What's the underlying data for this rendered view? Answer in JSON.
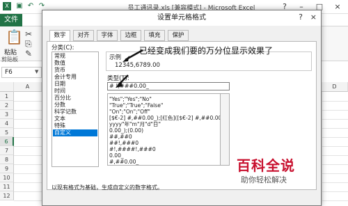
{
  "excel": {
    "title": "员工通讯录.xls [兼容模式] - Microsoft Excel",
    "file_tab": "文件",
    "paste_label": "粘贴",
    "clipboard_label": "剪贴板",
    "name_box": "F6",
    "columns": [
      "A",
      "B",
      "C",
      "D"
    ],
    "rows": [
      "1",
      "2",
      "3",
      "4",
      "5",
      "6",
      "7",
      "8",
      "9",
      "10",
      "11",
      "12"
    ],
    "selected_row": "6",
    "accent": "#217346"
  },
  "dialog": {
    "title": "设置单元格格式",
    "help": "?",
    "close": "×",
    "tabs": [
      "数字",
      "对齐",
      "字体",
      "边框",
      "填充",
      "保护"
    ],
    "active_tab": "数字",
    "category_label": "分类(C):",
    "categories": [
      "常规",
      "数值",
      "货币",
      "会计专用",
      "日期",
      "时间",
      "百分比",
      "分数",
      "科学记数",
      "文本",
      "特殊",
      "自定义"
    ],
    "selected_category": "自定义",
    "sample_label": "示例",
    "sample_value": "12345,6789.00",
    "type_label": "类型(T):",
    "type_value": "# !,###0.00_",
    "formats": [
      "\"Yes\";\"Yes\";\"No\"",
      "\"True\";\"True\";\"False\"",
      "\"On\";\"On\";\"Off\"",
      "[$€-2] #,##0.00_);[红色]([$€-2] #,##0.00)",
      "yyyy\"年\"m\"月\"d\"日\"",
      "0.00_);(0.00)",
      "##,##0",
      "##!,###0",
      "#!,####!,###0",
      "0.00_",
      "#,##0.00_"
    ],
    "description": "以现有格式为基础，生成自定义的数字格式。",
    "selection_color": "#0078d7"
  },
  "annotation": "已经变成我们要的万分位显示效果了",
  "watermark": {
    "main": "百科全说",
    "sub": "助你轻松解决",
    "color": "#c8102e"
  }
}
